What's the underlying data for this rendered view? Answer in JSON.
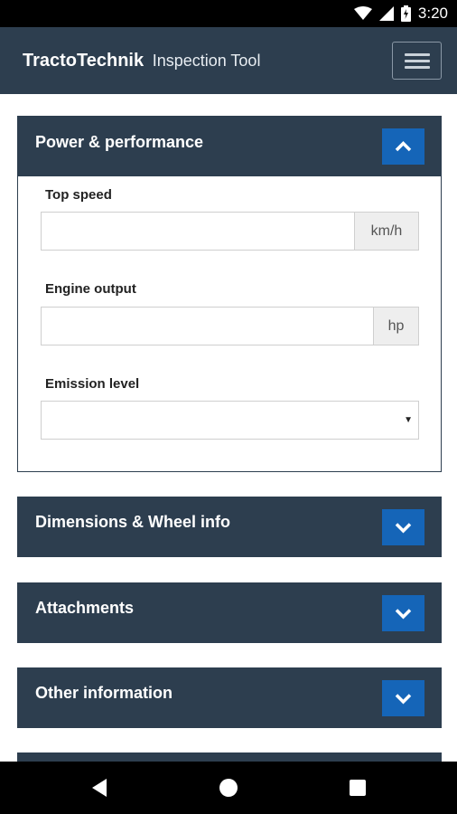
{
  "status_bar": {
    "time": "3:20",
    "icons": [
      "wifi-icon",
      "signal-icon",
      "battery-icon"
    ]
  },
  "app_bar": {
    "brand_bold": "TractoTechnik",
    "brand_light": "Inspection Tool",
    "menu_icon": "hamburger-menu-icon"
  },
  "colors": {
    "header_bg": "#2d3e4f",
    "accent_button": "#1565b8",
    "addon_bg": "#eeeeee"
  },
  "sections": {
    "power": {
      "title": "Power & performance",
      "expanded": true,
      "toggle_icon": "chevron-up-icon",
      "fields": {
        "top_speed": {
          "label": "Top speed",
          "value": "",
          "unit": "km/h"
        },
        "engine_output": {
          "label": "Engine output",
          "value": "",
          "unit": "hp"
        },
        "emission_level": {
          "label": "Emission level",
          "selected": ""
        }
      }
    },
    "dimensions": {
      "title": "Dimensions & Wheel info",
      "expanded": false,
      "toggle_icon": "chevron-down-icon"
    },
    "attachments": {
      "title": "Attachments",
      "expanded": false,
      "toggle_icon": "chevron-down-icon"
    },
    "other": {
      "title": "Other information",
      "expanded": false,
      "toggle_icon": "chevron-down-icon"
    }
  },
  "nav_bar": {
    "icons": [
      "back-icon",
      "home-icon",
      "recents-icon"
    ]
  }
}
